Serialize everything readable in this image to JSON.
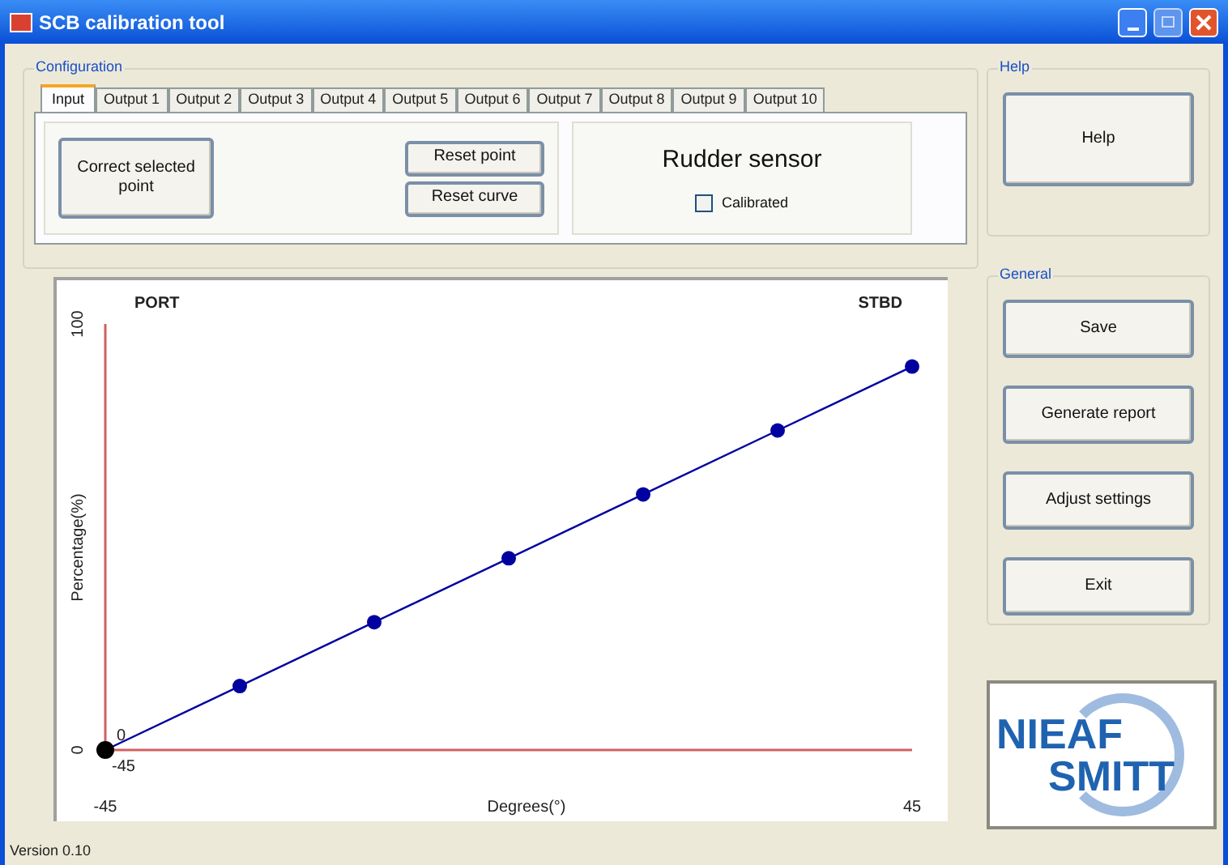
{
  "window": {
    "title": "SCB calibration tool"
  },
  "configuration": {
    "title": "Configuration",
    "tabs": [
      {
        "label": "Input",
        "selected": true
      },
      {
        "label": "Output 1",
        "selected": false
      },
      {
        "label": "Output 2",
        "selected": false
      },
      {
        "label": "Output 3",
        "selected": false
      },
      {
        "label": "Output 4",
        "selected": false
      },
      {
        "label": "Output 5",
        "selected": false
      },
      {
        "label": "Output 6",
        "selected": false
      },
      {
        "label": "Output 7",
        "selected": false
      },
      {
        "label": "Output 8",
        "selected": false
      },
      {
        "label": "Output 9",
        "selected": false
      },
      {
        "label": "Output 10",
        "selected": false
      }
    ],
    "buttons": [
      "Correct selected point",
      "Reset point",
      "Reset curve"
    ],
    "sensor": {
      "name": "Rudder sensor",
      "calibrated_label": "Calibrated",
      "checked": false
    }
  },
  "chart": {
    "chart_data": {
      "type": "line",
      "xlabel": "Degrees(°)",
      "ylabel": "Percentage(%)",
      "x": [
        -45,
        -30,
        -15,
        0,
        15,
        30,
        45
      ],
      "series": [
        {
          "color": "#0000a0",
          "marker": "circle",
          "values": [
            0,
            15,
            30,
            45,
            60,
            75,
            90
          ]
        },
        {
          "color": "#000000",
          "marker": "circle",
          "values": [
            0,
            null,
            null,
            null,
            null,
            null,
            null
          ]
        }
      ],
      "xlim": [
        -45,
        45
      ],
      "ylim": [
        0,
        100
      ],
      "xticks": [
        -45,
        45
      ],
      "yticks": [
        0,
        100
      ],
      "annotations": [
        {
          "text": "PORT"
        },
        {
          "text": "STBD"
        },
        {
          "text": "0"
        },
        {
          "text": "-45"
        }
      ]
    }
  },
  "help": {
    "title": "Help",
    "buttons": [
      "Help"
    ]
  },
  "general": {
    "title": "General",
    "buttons": [
      "Save",
      "Generate report",
      "Adjust settings",
      "Exit"
    ]
  },
  "logo": {
    "lines": [
      "NIEAF",
      "SMITT"
    ]
  },
  "status_bar": "Version 0.10"
}
